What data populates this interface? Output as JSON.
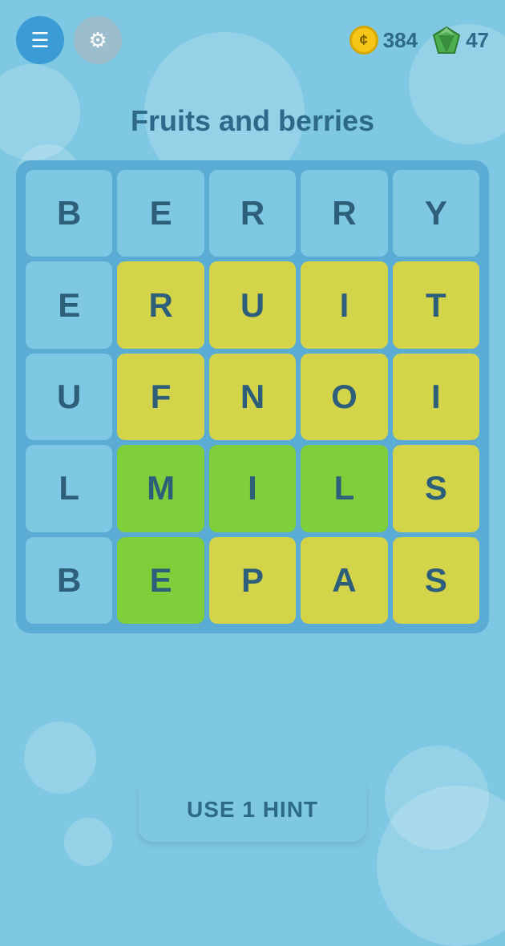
{
  "header": {
    "menu_label": "☰",
    "settings_label": "⚙",
    "coins": "384",
    "gems": "47",
    "coin_symbol": "¢",
    "gem_symbol": "◆"
  },
  "page": {
    "title": "Fruits and berries"
  },
  "grid": {
    "rows": [
      [
        {
          "letter": "B",
          "color": "blue"
        },
        {
          "letter": "E",
          "color": "blue"
        },
        {
          "letter": "R",
          "color": "blue"
        },
        {
          "letter": "R",
          "color": "blue"
        },
        {
          "letter": "Y",
          "color": "blue"
        }
      ],
      [
        {
          "letter": "E",
          "color": "blue"
        },
        {
          "letter": "R",
          "color": "yellow"
        },
        {
          "letter": "U",
          "color": "yellow"
        },
        {
          "letter": "I",
          "color": "yellow"
        },
        {
          "letter": "T",
          "color": "yellow"
        }
      ],
      [
        {
          "letter": "U",
          "color": "blue"
        },
        {
          "letter": "F",
          "color": "yellow"
        },
        {
          "letter": "N",
          "color": "yellow"
        },
        {
          "letter": "O",
          "color": "yellow"
        },
        {
          "letter": "I",
          "color": "yellow"
        }
      ],
      [
        {
          "letter": "L",
          "color": "blue"
        },
        {
          "letter": "M",
          "color": "green"
        },
        {
          "letter": "I",
          "color": "green"
        },
        {
          "letter": "L",
          "color": "green"
        },
        {
          "letter": "S",
          "color": "yellow"
        }
      ],
      [
        {
          "letter": "B",
          "color": "blue"
        },
        {
          "letter": "E",
          "color": "green"
        },
        {
          "letter": "P",
          "color": "yellow"
        },
        {
          "letter": "A",
          "color": "yellow"
        },
        {
          "letter": "S",
          "color": "yellow"
        }
      ]
    ]
  },
  "hint_button": {
    "label": "USE 1 HINT"
  }
}
